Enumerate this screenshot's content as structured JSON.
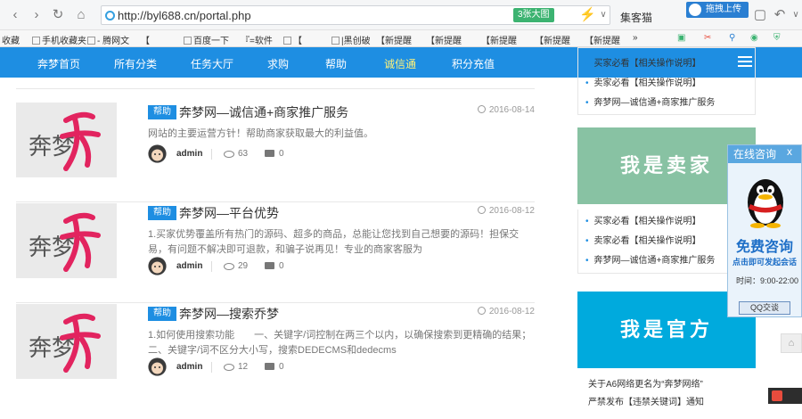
{
  "browser": {
    "url": "http://byl688.cn/portal.php",
    "zoom_badge": "3张大图",
    "search_hint": "集客猫",
    "upload_popup": "拖拽上传",
    "bookmarks": [
      "收藏",
      "手机收藏夹",
      "- 腾网文",
      "【",
      "百度一下",
      "『=软件",
      "【",
      "|黑创破",
      "【新提醒",
      "【新提醒",
      "【新提醒",
      "【新提醒",
      "【新提醒",
      "»"
    ]
  },
  "nav": {
    "items": [
      "奔梦首页",
      "所有分类",
      "任务大厅",
      "求购",
      "帮助",
      "诚信通",
      "积分充值"
    ],
    "active_index": 5
  },
  "articles": [
    {
      "tag": "帮助",
      "title": "奔梦网—诚信通+商家推广服务",
      "date": "2016-08-14",
      "desc": "网站的主要运营方针！帮助商家获取最大的利益值。",
      "author": "admin",
      "views": "63",
      "comments": "0",
      "thumb_text": "奔梦"
    },
    {
      "tag": "帮助",
      "title": "奔梦网—平台优势",
      "date": "2016-08-12",
      "desc": "1.买家优势覆盖所有热门的源码、超多的商品，总能让您找到自己想要的源码！担保交易，有问题不解决即可退款，和骗子说再见！专业的商家客服为",
      "author": "admin",
      "views": "29",
      "comments": "0",
      "thumb_text": "奔梦"
    },
    {
      "tag": "帮助",
      "title": "奔梦网—搜索乔梦",
      "date": "2016-08-12",
      "desc": "1.如何使用搜索功能　　一、关键字/词控制在两三个以内，以确保搜索到更精确的结果；　　二、关键字/词不区分大小写，搜索DEDECMS和dedecms",
      "author": "admin",
      "views": "12",
      "comments": "0",
      "thumb_text": "奔梦"
    }
  ],
  "sidebar": {
    "top_list": [
      "买家必看【相关操作说明】",
      "卖家必看【相关操作说明】",
      "奔梦网—诚信通+商家推广服务"
    ],
    "seller_banner": "我是卖家",
    "seller_list": [
      "买家必看【相关操作说明】",
      "卖家必看【相关操作说明】",
      "奔梦网—诚信通+商家推广服务"
    ],
    "official_banner": "我是官方",
    "news": [
      "关于A6网络更名为“奔梦网络”",
      "严禁发布【违禁关键词】通知"
    ]
  },
  "qq_widget": {
    "title": "在线咨询",
    "close": "x",
    "free": "免费咨询",
    "sub": "点击即可发起会话",
    "time": "时间：9:00-22:00",
    "button": "QQ交谈"
  },
  "colors": {
    "nav_bg": "#1e8ee2",
    "accent_text": "#fff27a",
    "seller_banner": "#88c2a3",
    "official_banner": "#00aadd",
    "thumb_ink": "#e2245f"
  }
}
